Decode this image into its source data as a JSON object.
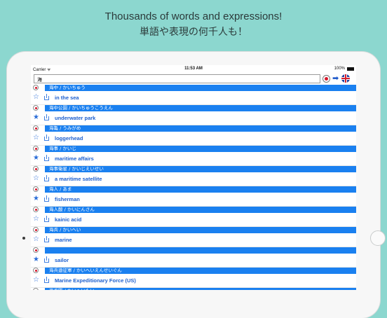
{
  "headline": {
    "line1": "Thousands of words and expressions!",
    "line2": "単語や表現の何千人も！"
  },
  "statusbar": {
    "carrier": "Carrier ᯤ",
    "time": "11:53 AM",
    "battery": "100%"
  },
  "search": {
    "value": "海"
  },
  "entries": [
    {
      "jp": "海中 / かいちゅう",
      "en": "in the sea",
      "starred": false
    },
    {
      "jp": "海中公園 / かいちゅうこうえん",
      "en": "underwater park",
      "starred": true
    },
    {
      "jp": "海亀 / うみがめ",
      "en": "loggerhead",
      "starred": false
    },
    {
      "jp": "海事 / かいじ",
      "en": "maritime affairs",
      "starred": true
    },
    {
      "jp": "海事衛星 / かいじえいせい",
      "en": "a maritime satellite",
      "starred": false
    },
    {
      "jp": "海人 / あま",
      "en": "fisherman",
      "starred": true
    },
    {
      "jp": "海人酸 / かいにんさん",
      "en": "kainic acid",
      "starred": false
    },
    {
      "jp": "海兵 / かいへい",
      "en": "marine",
      "starred": false
    },
    {
      "jp": "",
      "en": "sailor",
      "starred": true
    },
    {
      "jp": "海兵遠征軍 / かいへいえんせいぐん",
      "en": "Marine Expeditionary Force (US)",
      "starred": false
    },
    {
      "jp": "海兵隊 / かいへいたい",
      "en": "",
      "starred": false
    }
  ],
  "colors": {
    "background": "#8cd7cf",
    "jp_bar": "#1a80f0",
    "english_text": "#1d5fce",
    "record_dot": "#d7162b"
  },
  "icons": {
    "record": "record-icon",
    "arrow": "arrow-right-icon",
    "flag": "uk-flag-icon",
    "star": "star-icon",
    "share": "share-icon"
  }
}
